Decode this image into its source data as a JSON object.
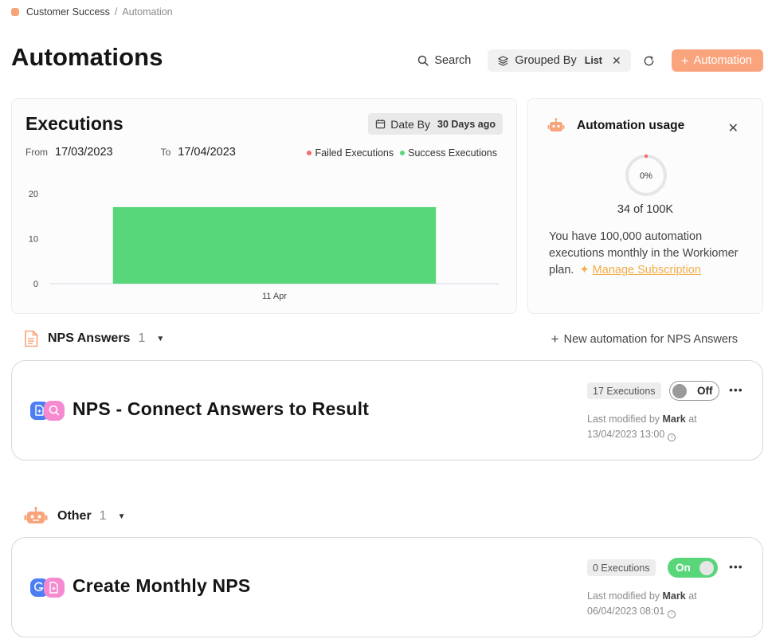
{
  "breadcrumb": {
    "root": "Customer Success",
    "separator": "/",
    "current": "Automation"
  },
  "page": {
    "title": "Automations"
  },
  "header": {
    "search_label": "Search",
    "group_label": "Grouped By",
    "group_value": "List",
    "add_label": "Automation"
  },
  "executions": {
    "title": "Executions",
    "date_by_label": "Date By",
    "date_by_value": "30 Days ago",
    "from_label": "From",
    "from_value": "17/03/2023",
    "to_label": "To",
    "to_value": "17/04/2023",
    "legend_failed": "Failed Executions",
    "legend_success": "Success Executions"
  },
  "chart_data": {
    "type": "bar",
    "categories": [
      "11 Apr"
    ],
    "series": [
      {
        "name": "Failed Executions",
        "color": "#f36b6b",
        "values": [
          0
        ]
      },
      {
        "name": "Success Executions",
        "color": "#58d67a",
        "values": [
          17
        ]
      }
    ],
    "yticks": [
      0,
      10,
      20
    ],
    "ylim": [
      0,
      20
    ],
    "legend": "top-right"
  },
  "usage": {
    "title": "Automation usage",
    "percent_label": "0%",
    "percent": 0,
    "count": "34 of 100K",
    "text": "You have 100,000 automation executions monthly in the Workiomer plan.",
    "link": "Manage Subscription"
  },
  "groups": [
    {
      "name": "NPS Answers",
      "count": "1",
      "new_label": "New automation for NPS Answers",
      "cards": [
        {
          "title": "NPS - Connect Answers to Result",
          "executions": "17 Executions",
          "toggle": "Off",
          "modified_prefix": "Last modified by",
          "modified_by": "Mark",
          "modified_at": "at",
          "modified_date": "13/04/2023 13:00"
        }
      ]
    },
    {
      "name": "Other",
      "count": "1",
      "cards": [
        {
          "title": "Create Monthly NPS",
          "executions": "0 Executions",
          "toggle": "On",
          "modified_prefix": "Last modified by",
          "modified_by": "Mark",
          "modified_at": "at",
          "modified_date": "06/04/2023 08:01"
        }
      ]
    }
  ],
  "colors": {
    "accent": "#f9a47c",
    "success": "#58d67a",
    "failed": "#f36b6b",
    "link": "#f2ad48"
  }
}
